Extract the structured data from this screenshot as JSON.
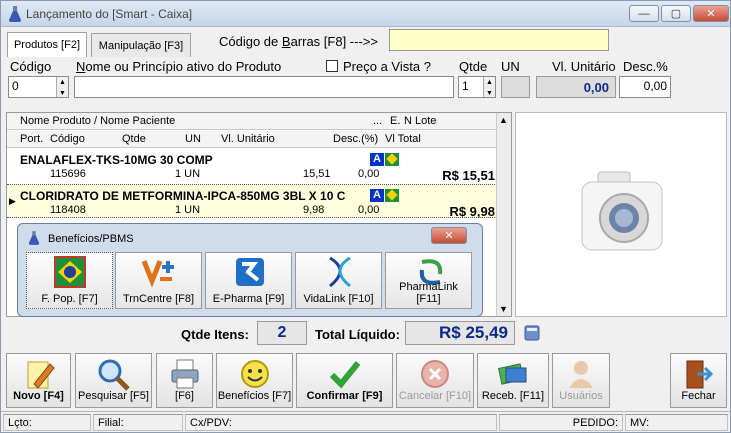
{
  "window": {
    "title": "Lançamento do [Smart - Caixa]"
  },
  "tabs": [
    {
      "label": "Produtos [F2]"
    },
    {
      "label": "Manipulação [F3]"
    }
  ],
  "barcode": {
    "label_prefix": "Código de ",
    "label_hot": "B",
    "label_suffix": "arras [F8] --->>",
    "value": ""
  },
  "product_form": {
    "codigo_label": "Código",
    "codigo_value": "0",
    "nome_label_hot": "N",
    "nome_label_rest": "ome ou Princípio ativo do Produto",
    "nome_value": "",
    "preco_vista_label": "Preço a Vista ?",
    "qtde_label": "Qtde",
    "qtde_value": "1",
    "un_label": "UN",
    "un_value": "",
    "vl_unitario_label": "Vl. Unitário",
    "vl_unitario_value": "0,00",
    "desc_label": "Desc.%",
    "desc_value": "0,00"
  },
  "grid": {
    "header1": {
      "nome": "Nome Produto / Nome Paciente",
      "dots": "...",
      "e": "E.",
      "lote": "N Lote"
    },
    "header2": {
      "port": "Port.",
      "codigo": "Código",
      "qtde": "Qtde",
      "un": "UN",
      "vl_unitario": "Vl. Unitário",
      "desc": "Desc.(%)",
      "vl_total": "Vl Total"
    },
    "rows": [
      {
        "name": "ENALAFLEX-TKS-10MG 30 COMP",
        "badge": "A",
        "codigo": "115696",
        "qtde_un": "1 UN",
        "vl_unitario": "15,51",
        "desc": "0,00",
        "total": "R$ 15,51"
      },
      {
        "name": "CLORIDRATO DE METFORMINA-IPCA-850MG 3BL X 10 C",
        "badge": "A",
        "codigo": "118408",
        "qtde_un": "1 UN",
        "vl_unitario": "9,98",
        "desc": "0,00",
        "total": "R$ 9,98"
      }
    ]
  },
  "popup": {
    "title": "Benefícios/PBMS",
    "buttons": [
      {
        "label": "F. Pop. [F7]"
      },
      {
        "label": "TrnCentre [F8]"
      },
      {
        "label": "E-Pharma [F9]"
      },
      {
        "label": "VidaLink [F10]"
      },
      {
        "label": "PharmaLink [F11]"
      }
    ]
  },
  "totals": {
    "qtde_label": "Qtde Itens:",
    "qtde_value": "2",
    "total_label": "Total Líquido:",
    "total_value": "R$ 25,49"
  },
  "toolbar": {
    "novo": "Novo [F4]",
    "pesquisar": "Pesquisar [F5]",
    "f6": "[F6]",
    "beneficios": "Benefícios [F7]",
    "confirmar": "Confirmar [F9]",
    "cancelar": "Cancelar [F10]",
    "receb": "Receb. [F11]",
    "usuarios": "Usuários",
    "fechar": "Fechar"
  },
  "statusbar": {
    "lcto": "Lçto:",
    "filial": "Filial:",
    "cxpdv": "Cx/PDV:",
    "pedido": "PEDIDO:",
    "mv": "MV:"
  }
}
